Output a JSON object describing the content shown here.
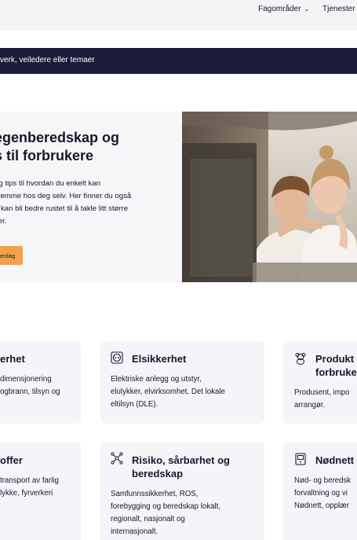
{
  "nav": {
    "fagomrader_label": "Fagområder",
    "tjenester_label": "Tjenester"
  },
  "search": {
    "placeholder": "verk, veiledere eller temaer"
  },
  "hero": {
    "title_line1": "egenberedskap og",
    "title_line2": "s til forbrukere",
    "text_line1": "og tips til hvordan du enkelt kan",
    "text_line2": "hjemme hos deg selv. Her finner du også",
    "text_line3": "u kan bli bedre rustet til å takle litt større",
    "text_line4": "ser.",
    "button_label": "erdag"
  },
  "cards": {
    "c1": {
      "title": "erhet",
      "desc_line1": "dimensjonering",
      "desc_line2": "ogbrann, tilsyn og"
    },
    "c2": {
      "icon": "socket-icon",
      "title": "Elsikkerhet",
      "desc_line1": "Elektriske anlegg og utstyr,",
      "desc_line2": "elulykker, elvirksomhet, Det lokale",
      "desc_line3": "eltilsyn (DLE)."
    },
    "c3": {
      "icon": "teddy-bear-icon",
      "title_line1": "Produkt",
      "title_line2": "forbruke",
      "desc_line1": "Produsent, impo",
      "desc_line2": "arrangør."
    },
    "c4": {
      "title": "offer",
      "desc_line1": "transport av farlig",
      "desc_line2": "lykke, fyrverkeri"
    },
    "c5": {
      "icon": "network-icon",
      "title_line1": "Risiko, sårbarhet og",
      "title_line2": "beredskap",
      "desc_line1": "Samfunnssikkerhet, ROS,",
      "desc_line2": "forebygging og beredskap lokalt,",
      "desc_line3": "regionalt, nasjonalt og",
      "desc_line4": "internasjonalt."
    },
    "c6": {
      "icon": "radio-terminal-icon",
      "title": "Nødnett",
      "desc_line1": "Nød- og beredsk",
      "desc_line2": "forvaltning og vi",
      "desc_line3": "Nødnett, opplær"
    }
  },
  "colors": {
    "dark_navy": "#1c1c3a",
    "accent_orange": "#f0a34a",
    "card_bg": "#f4f5f9",
    "hero_bg": "#f6f6f9"
  }
}
